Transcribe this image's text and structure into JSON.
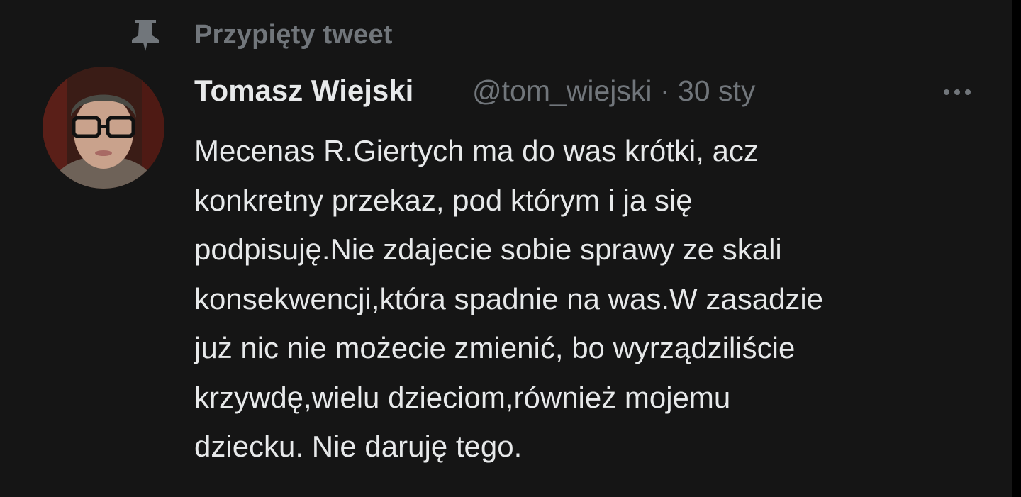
{
  "pinned": {
    "label": "Przypięty tweet",
    "icon": "pin-icon"
  },
  "tweet": {
    "author_name": "Tomasz Wiejski",
    "handle": "@tom_wiejski",
    "separator": "·",
    "date": "30 sty",
    "more_icon": "more-horizontal-icon",
    "avatar_icon": "avatar",
    "text_lines": [
      "Mecenas R.Giertych ma do was krótki, acz",
      "konkretny przekaz, pod którym i ja się",
      "podpisuję.Nie zdajecie sobie sprawy ze skali",
      "konsekwencji,która spadnie na was.W zasadzie",
      "już nic nie możecie zmienić, bo wyrządziliście",
      "krzywdę,wielu dzieciom,również mojemu",
      "dziecku. Nie daruję tego."
    ]
  },
  "colors": {
    "background": "#151515",
    "primary_text": "#e7e9ea",
    "secondary_text": "#71767b"
  }
}
